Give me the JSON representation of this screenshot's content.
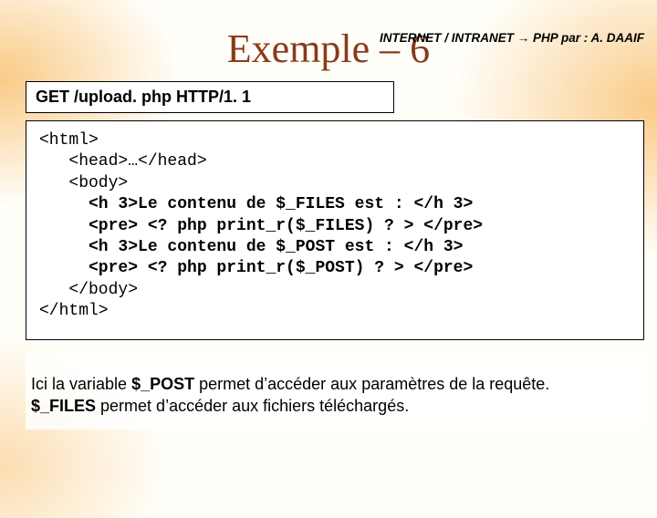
{
  "header": {
    "left": "INTERNET / INTRANET",
    "arrow": "→",
    "mid": "PHP par :",
    "author": "A. DAAIF"
  },
  "title": "Exemple – 6",
  "request": "GET  /upload. php HTTP/1. 1",
  "code": {
    "l1": "<html>",
    "l2": "   <head>…</head>",
    "l3": "   <body>",
    "l4": "     <h 3>Le contenu de $_FILES est : </h 3>",
    "l5": "     <pre> <? php print_r($_FILES) ? > </pre>",
    "l6": "     <h 3>Le contenu de $_POST est : </h 3>",
    "l7": "     <pre> <? php print_r($_POST) ? > </pre>",
    "l8": "   </body>",
    "l9": "</html>"
  },
  "explain": {
    "p1a": "Ici la variable ",
    "p1b": "$_POST",
    "p1c": " permet d’accéder aux paramètres de la requête.",
    "p2a": "$_FILES",
    "p2b": " permet d’accéder aux fichiers téléchargés."
  }
}
